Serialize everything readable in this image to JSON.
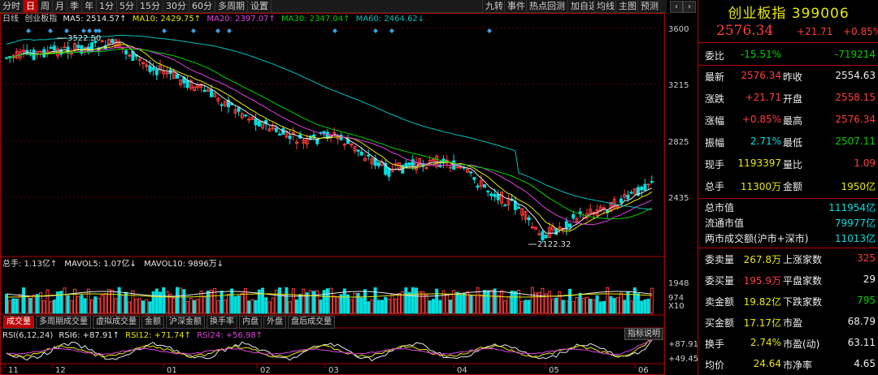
{
  "toolbar": {
    "periods": [
      "分时",
      "日",
      "周",
      "月",
      "季",
      "年",
      "1分",
      "5分",
      "15分",
      "30分",
      "60分",
      "多周期",
      "设置"
    ],
    "selected": "日",
    "right_items": [
      "九转",
      "事件",
      "热点回测",
      "加自选",
      "均线",
      "主图",
      "预测"
    ],
    "prev_icon": "‹",
    "next_icon": "›"
  },
  "main_legend": {
    "name": "日线",
    "index": "创业板指",
    "ma5": "MA5: 2514.57↑",
    "ma10": "MA10: 2429.75↑",
    "ma20": "MA20: 2397.07↑",
    "ma30": "MA30: 2347.04↑",
    "ma60": "MA60: 2464.62↓"
  },
  "price_axis": [
    "3600",
    "3215",
    "2825",
    "2435"
  ],
  "annotations": {
    "high": "3522.50",
    "low": "2122.32"
  },
  "vol_legend": {
    "total": "总手: 1.13亿↑",
    "mavol5": "MAVOL5: 1.07亿↓",
    "mavol10": "MAVOL10: 9896万↓"
  },
  "vol_axis": [
    "1948",
    "974",
    "X10"
  ],
  "indicator_tabs": [
    "成交量",
    "多周期成交量",
    "虚拟成交量",
    "金额",
    "沪深金额",
    "换手率",
    "内盘",
    "外盘",
    "盘后成交量"
  ],
  "indicator_selected": "成交量",
  "rsi_legend": {
    "name": "RSI(6,12,24)",
    "rsi6": "RSI6: +87.91↑",
    "rsi12": "RSI12: +71.74↑",
    "rsi24": "RSI24: +56.98↑"
  },
  "rsi_axis": [
    "+87.91",
    "+49.45"
  ],
  "rsi_help": "指标说明",
  "date_axis": [
    "11",
    "12",
    "01",
    "02",
    "03",
    "04",
    "05",
    "06"
  ],
  "colors": {
    "up": "#ff3c3c",
    "down": "#00e0e0",
    "ma5": "#e8e8e8",
    "ma10": "#e8e800",
    "ma20": "#e040e0",
    "ma30": "#00d000",
    "ma60": "#00c0c0",
    "panel_border": "#b00000"
  },
  "quote": {
    "title": "创业板指 399006",
    "price": "2576.34",
    "change": "+21.71",
    "pct": "+0.85%",
    "rows1": [
      {
        "l": "委比",
        "v": "-15.51%",
        "l2": "",
        "v2": "-719214",
        "c": "green",
        "c2": "green"
      }
    ],
    "rows2": [
      {
        "l": "最新",
        "v": "2576.34",
        "l2": "昨收",
        "v2": "2554.63",
        "c": "red",
        "c2": "white"
      },
      {
        "l": "涨跌",
        "v": "+21.71",
        "l2": "开盘",
        "v2": "2558.15",
        "c": "red",
        "c2": "red"
      },
      {
        "l": "涨幅",
        "v": "+0.85%",
        "l2": "最高",
        "v2": "2576.34",
        "c": "red",
        "c2": "red"
      },
      {
        "l": "振幅",
        "v": "2.71%",
        "l2": "最低",
        "v2": "2507.11",
        "c": "cyan",
        "c2": "green"
      },
      {
        "l": "现手",
        "v": "1193397",
        "l2": "量比",
        "v2": "1.09",
        "c": "yellow",
        "c2": "red"
      },
      {
        "l": "总手",
        "v": "11300万",
        "l2": "金额",
        "v2": "1950亿",
        "c": "yellow",
        "c2": "yellow"
      }
    ],
    "rows3": [
      {
        "l": "总市值",
        "v": "111954亿",
        "c": "cyan"
      },
      {
        "l": "流通市值",
        "v": "79977亿",
        "c": "cyan"
      },
      {
        "l": "两市成交额(沪市+深市)",
        "v": "11013亿",
        "c": "cyan"
      }
    ],
    "rows4": [
      {
        "l": "委卖量",
        "v": "267.8万",
        "l2": "上涨家数",
        "v2": "325",
        "c": "yellow",
        "c2": "red"
      },
      {
        "l": "委买量",
        "v": "195.9万",
        "l2": "平盘家数",
        "v2": "29",
        "c": "red",
        "c2": "white"
      },
      {
        "l": "卖金额",
        "v": "19.82亿",
        "l2": "下跌家数",
        "v2": "795",
        "c": "yellow",
        "c2": "green"
      },
      {
        "l": "买金额",
        "v": "17.17亿",
        "l2": "市盈",
        "v2": "68.79",
        "c": "yellow",
        "c2": "white"
      },
      {
        "l": "换手",
        "v": "2.74%",
        "l2": "市盈(动)",
        "v2": "63.11",
        "c": "yellow",
        "c2": "white"
      },
      {
        "l": "均价",
        "v": "24.64",
        "l2": "市净率",
        "v2": "4.65",
        "c": "yellow",
        "c2": "white"
      }
    ]
  }
}
